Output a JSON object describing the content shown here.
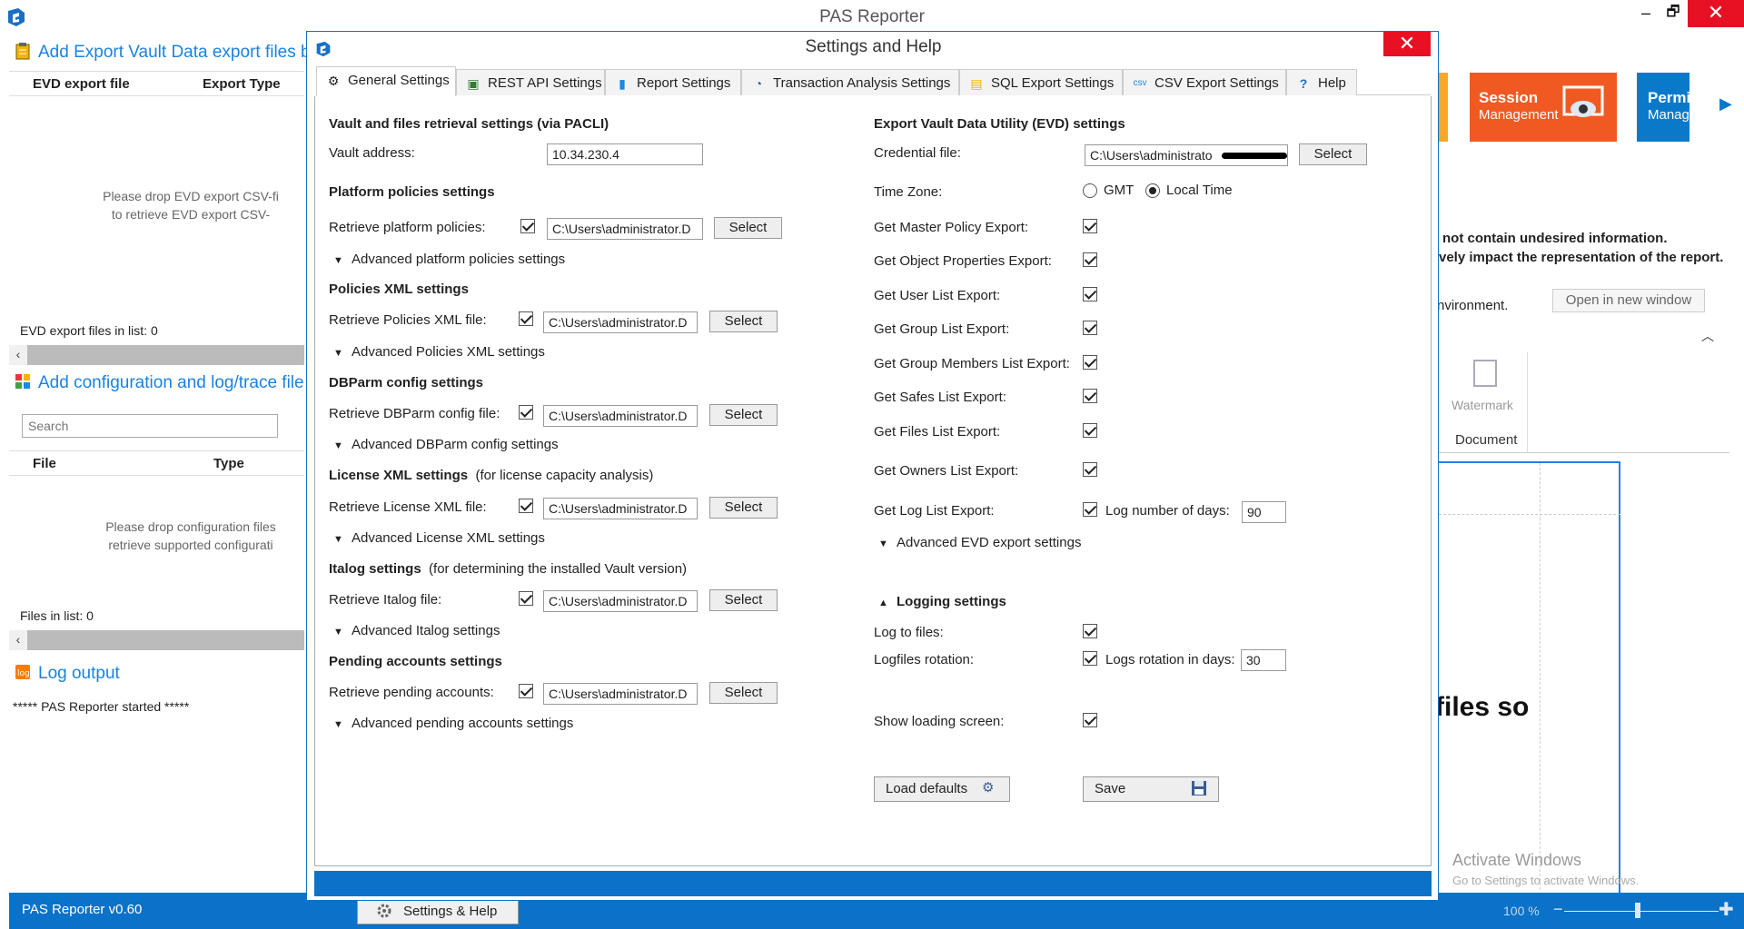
{
  "app": {
    "title": "PAS Reporter",
    "min": "–",
    "restore": "🗗",
    "close": "✕"
  },
  "left": {
    "evd_header": "Add Export Vault Data export files b",
    "evd_cols": [
      "EVD export file",
      "Export Type"
    ],
    "evd_hint_1": "Please drop EVD export CSV-fi",
    "evd_hint_2": "to retrieve EVD export CSV-",
    "evd_count": "EVD export files in list: 0",
    "config_header": "Add configuration and log/trace file",
    "search_placeholder": "Search",
    "file_cols": [
      "File",
      "Type"
    ],
    "files_hint_1": "Please drop configuration files",
    "files_hint_2": "retrieve supported configurati",
    "files_count": "Files in list: 0",
    "log_header": "Log output",
    "log_text": "***** PAS Reporter started *****",
    "scroll_arrow": "‹"
  },
  "status": {
    "version": "PAS Reporter v0.60",
    "settings_help": "Settings & Help",
    "zoom": "100 %",
    "minus": "−",
    "plus": "✚"
  },
  "behind": {
    "session_title": "Session",
    "session_sub": "Management",
    "perm_title": "Permis",
    "perm_sub": "Manag",
    "ribbon_arrow": "▶",
    "warn_1": "not contain undesired information.",
    "warn_2": "vely impact the representation of the report.",
    "env": "nvironment.",
    "open_new_window": "Open in new window",
    "collapse": "︿",
    "watermark": "Watermark",
    "document": "Document",
    "big_text": "files so",
    "activate_1": "Activate Windows",
    "activate_2": "Go to Settings to activate Windows."
  },
  "dialog": {
    "title": "Settings and Help",
    "close": "✕",
    "tabs": [
      {
        "label": "General Settings",
        "icon": "gear-icon"
      },
      {
        "label": "REST API Settings",
        "icon": "api-icon"
      },
      {
        "label": "Report Settings",
        "icon": "bar-chart-icon"
      },
      {
        "label": "Transaction Analysis Settings",
        "icon": "gauge-icon"
      },
      {
        "label": "SQL Export Settings",
        "icon": "database-icon"
      },
      {
        "label": "CSV Export Settings",
        "icon": "csv-icon"
      },
      {
        "label": "Help",
        "icon": "question-icon"
      }
    ],
    "left": {
      "vault_title": "Vault and files retrieval settings (via PACLI)",
      "vault_address_label": "Vault address:",
      "vault_address": "10.34.230.4",
      "platform_title": "Platform policies settings",
      "platform_label": "Retrieve platform policies:",
      "platform_path": "C:\\Users\\administrator.D",
      "platform_adv": "Advanced platform policies settings",
      "polxml_title": "Policies XML settings",
      "polxml_label": "Retrieve Policies XML file:",
      "polxml_path": "C:\\Users\\administrator.D",
      "polxml_adv": "Advanced Policies XML settings",
      "dbparm_title": "DBParm config settings",
      "dbparm_label": "Retrieve DBParm config file:",
      "dbparm_path": "C:\\Users\\administrator.D",
      "dbparm_adv": "Advanced DBParm config settings",
      "license_title": "License XML settings",
      "license_note": "(for license capacity analysis)",
      "license_label": "Retrieve License XML file:",
      "license_path": "C:\\Users\\administrator.D",
      "license_adv": "Advanced License XML settings",
      "italog_title": "Italog settings",
      "italog_note": "(for determining the installed Vault version)",
      "italog_label": "Retrieve Italog file:",
      "italog_path": "C:\\Users\\administrator.D",
      "italog_adv": "Advanced Italog settings",
      "pending_title": "Pending accounts settings",
      "pending_label": "Retrieve pending accounts:",
      "pending_path": "C:\\Users\\administrator.D",
      "pending_adv": "Advanced pending accounts settings",
      "select": "Select"
    },
    "right": {
      "evd_title": "Export Vault Data Utility (EVD) settings",
      "cred_label": "Credential file:",
      "cred_path": "C:\\Users\\administrato",
      "select": "Select",
      "tz_label": "Time Zone:",
      "tz_gmt": "GMT",
      "tz_local": "Local Time",
      "exports": [
        "Get Master Policy Export:",
        "Get Object Properties Export:",
        "Get User List Export:",
        "Get Group List Export:",
        "Get Group Members List Export:",
        "Get Safes List Export:",
        "Get Files List Export:",
        "Get Owners List Export:",
        "Get Log List Export:"
      ],
      "log_days_label": "Log number of days:",
      "log_days": "90",
      "adv_evd": "Advanced EVD export settings",
      "logging_title": "Logging settings",
      "log_to_files": "Log to files:",
      "logfiles_rotation": "Logfiles rotation:",
      "rotation_label": "Logs rotation in days:",
      "rotation_days": "30",
      "loading_screen": "Show loading screen:",
      "load_defaults": "Load defaults",
      "save": "Save"
    }
  }
}
